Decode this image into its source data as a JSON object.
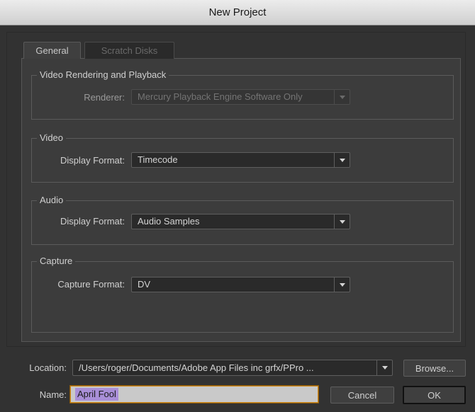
{
  "window": {
    "title": "New Project"
  },
  "tabs": [
    {
      "label": "General",
      "active": true
    },
    {
      "label": "Scratch Disks",
      "active": false
    }
  ],
  "groups": {
    "video_rendering": {
      "legend": "Video Rendering and Playback",
      "renderer_label": "Renderer:",
      "renderer_value": "Mercury Playback Engine Software Only"
    },
    "video": {
      "legend": "Video",
      "display_format_label": "Display Format:",
      "display_format_value": "Timecode"
    },
    "audio": {
      "legend": "Audio",
      "display_format_label": "Display Format:",
      "display_format_value": "Audio Samples"
    },
    "capture": {
      "legend": "Capture",
      "capture_format_label": "Capture Format:",
      "capture_format_value": "DV"
    }
  },
  "footer": {
    "location_label": "Location:",
    "location_value": "/Users/roger/Documents/Adobe App Files inc grfx/PPro ...",
    "browse_label": "Browse...",
    "name_label": "Name:",
    "name_value": "April Fool",
    "cancel_label": "Cancel",
    "ok_label": "OK"
  },
  "colors": {
    "background": "#323232",
    "panel": "#3c3c3c",
    "selection": "#a98fd8",
    "focus_ring": "#d08a1a"
  },
  "icons": {
    "dropdown_arrow": "chevron-down-icon"
  }
}
